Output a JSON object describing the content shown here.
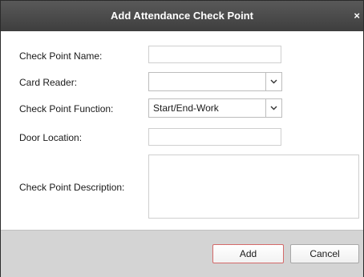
{
  "dialog": {
    "title": "Add Attendance Check Point",
    "close_glyph": "×"
  },
  "form": {
    "check_point_name": {
      "label": "Check Point Name:",
      "value": ""
    },
    "card_reader": {
      "label": "Card Reader:",
      "selected": ""
    },
    "check_point_function": {
      "label": "Check Point Function:",
      "selected": "Start/End-Work"
    },
    "door_location": {
      "label": "Door Location:",
      "value": ""
    },
    "check_point_description": {
      "label": "Check Point Description:",
      "value": ""
    }
  },
  "buttons": {
    "add": "Add",
    "cancel": "Cancel"
  },
  "icons": {
    "dropdown": "chevron-down-icon",
    "close": "close-icon"
  },
  "colors": {
    "titlebar": "#4a4a4a",
    "footer": "#d4d4d4",
    "add_border": "#d46a6a"
  }
}
